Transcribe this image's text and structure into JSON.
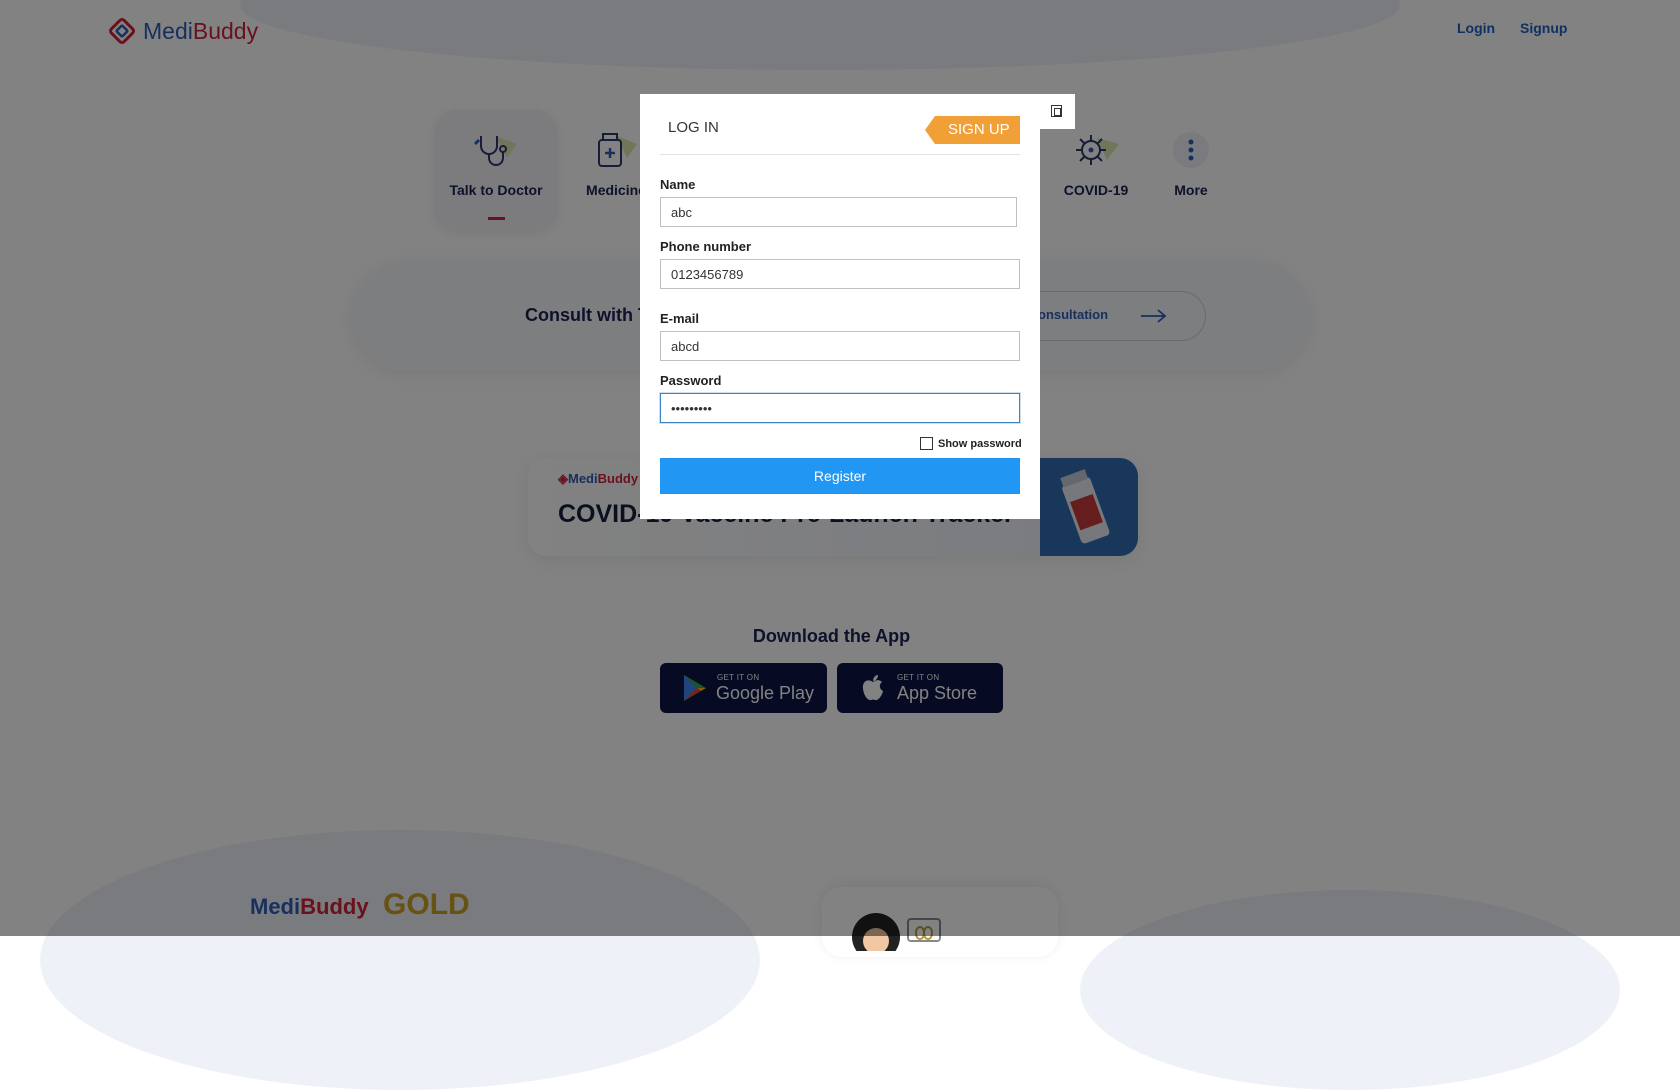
{
  "header": {
    "logo_medi": "Medi",
    "logo_buddy": "Buddy",
    "login": "Login",
    "signup": "Signup"
  },
  "categories": [
    {
      "label": "Talk to Doctor"
    },
    {
      "label": "Medicine"
    },
    {
      "label": "COVID-19"
    },
    {
      "label": "More"
    }
  ],
  "consult": {
    "text": "Consult with T",
    "button": "onsultation"
  },
  "banner": {
    "logo_medi": "Medi",
    "logo_buddy": "Buddy",
    "title": "COVID-19 Vaccine Pre-Launch Tracker"
  },
  "download": {
    "title": "Download the App",
    "google_small": "GET IT ON",
    "google_big": "Google Play",
    "apple_small": "GET IT ON",
    "apple_big": "App Store"
  },
  "gold": {
    "medi": "Medi",
    "buddy": "Buddy",
    "gold": "GOLD"
  },
  "modal": {
    "tab_login": "LOG IN",
    "tab_signup": "SIGN UP",
    "name_label": "Name",
    "name_value": "abc",
    "phone_label": "Phone number",
    "phone_value": "0123456789",
    "email_label": "E-mail",
    "email_value": "abcd",
    "password_label": "Password",
    "password_value": "abcdefghi",
    "show_password": "Show password",
    "register": "Register"
  },
  "colors": {
    "brand_blue": "#2d5fb8",
    "brand_red": "#d0223c",
    "signup_tab": "#f0a036",
    "register_button": "#2196f3",
    "app_badge": "#0c1446"
  }
}
